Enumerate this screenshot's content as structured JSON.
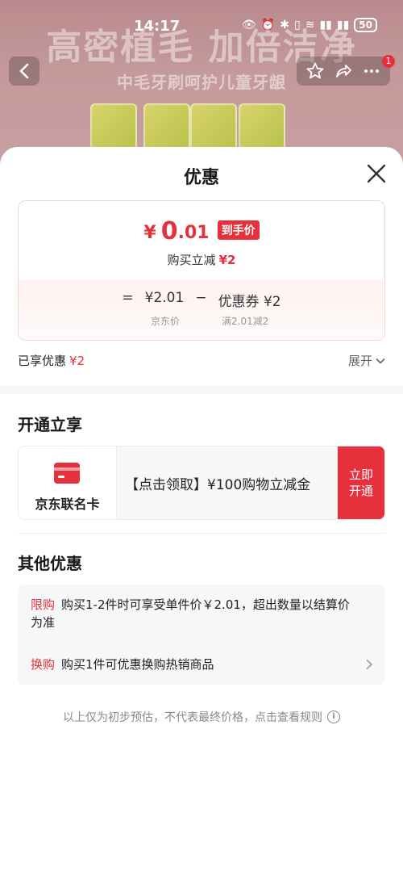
{
  "statusbar": {
    "time": "14:17",
    "battery": "50"
  },
  "background": {
    "headline": "高密植毛 加倍洁净",
    "subline": "中毛牙刷呵护儿童牙龈",
    "notification_count": "1"
  },
  "sheet": {
    "title": "优惠",
    "price": {
      "yen": "¥",
      "integer": "0",
      "decimal": ".01",
      "tag": "到手价",
      "reduce_label": "购买立减",
      "reduce_amount": "¥2"
    },
    "formula": {
      "eq": "=",
      "base": "¥2.01",
      "minus": "−",
      "coupon": "优惠券 ¥2",
      "base_caption": "京东价",
      "coupon_caption": "满2.01减2"
    },
    "enjoyed": {
      "label": "已享优惠",
      "amount": "¥2",
      "expand": "展开"
    },
    "open_section": {
      "title": "开通立享",
      "card_name": "京东联名卡",
      "offer": "【点击领取】¥100购物立减金",
      "button": "立即\n开通"
    },
    "other_section": {
      "title": "其他优惠",
      "item1_tag": "限购",
      "item1_text": "购买1-2件时可享受单件价￥2.01，超出数量以结算价为准",
      "item2_tag": "换购",
      "item2_text": "购买1件可优惠换购热销商品"
    },
    "footer": "以上仅为初步预估，不代表最终价格，点击查看规则"
  },
  "colors": {
    "accent": "#e6313d",
    "muted": "#888888"
  }
}
